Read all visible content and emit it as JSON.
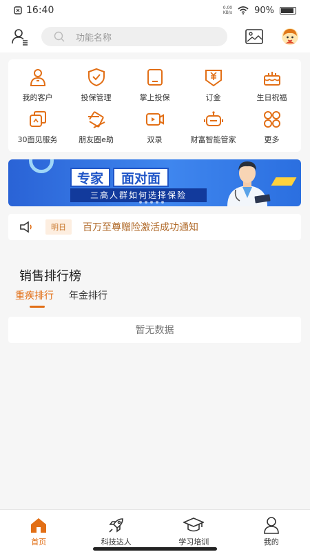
{
  "status": {
    "time": "16:40",
    "net_speed_top": "0.00",
    "net_speed_bottom": "KB/s",
    "battery": "90%",
    "battery_level": 0.9
  },
  "search": {
    "placeholder": "功能名称"
  },
  "grid": [
    {
      "label": "我的客户",
      "icon": "customer-icon"
    },
    {
      "label": "投保管理",
      "icon": "shield-check-icon"
    },
    {
      "label": "掌上投保",
      "icon": "tablet-icon"
    },
    {
      "label": "订金",
      "icon": "deposit-icon"
    },
    {
      "label": "生日祝福",
      "icon": "cake-icon"
    },
    {
      "label": "30面见服务",
      "icon": "meeting-icon"
    },
    {
      "label": "朋友圈e助",
      "icon": "aperture-icon"
    },
    {
      "label": "双录",
      "icon": "video-icon"
    },
    {
      "label": "财富智能管家",
      "icon": "robot-icon"
    },
    {
      "label": "更多",
      "icon": "more-grid-icon"
    }
  ],
  "banner": {
    "title_left": "专家",
    "title_right": "面对面",
    "subtitle": "三高人群如何选择保险"
  },
  "notice": {
    "tag": "明日",
    "text": "百万至尊赠险激活成功通知"
  },
  "sales": {
    "title": "销售排行榜",
    "tabs": [
      "重疾排行",
      "年金排行"
    ],
    "active_tab": 0,
    "empty_text": "暂无数据"
  },
  "nav": [
    {
      "label": "首页",
      "icon": "home-icon",
      "active": true
    },
    {
      "label": "科技达人",
      "icon": "rocket-icon",
      "active": false
    },
    {
      "label": "学习培训",
      "icon": "graduation-cap-icon",
      "active": false
    },
    {
      "label": "我的",
      "icon": "person-icon",
      "active": false
    }
  ],
  "colors": {
    "accent": "#e26f16",
    "banner_blue": "#2a63d6"
  }
}
